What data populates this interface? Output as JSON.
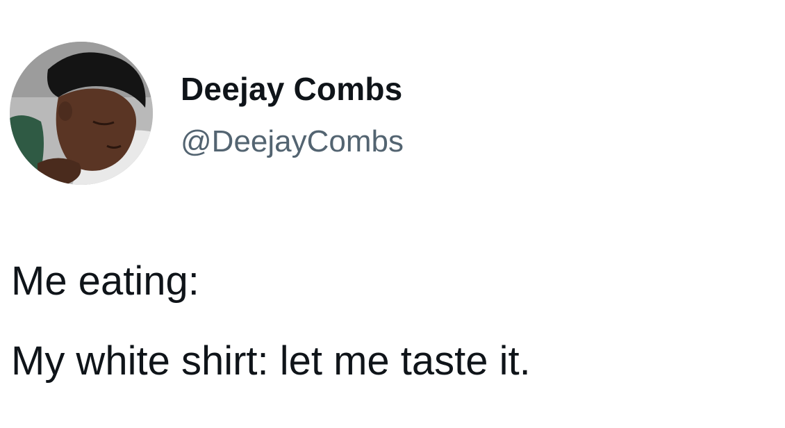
{
  "tweet": {
    "author": {
      "display_name": "Deejay Combs",
      "handle": "@DeejayCombs",
      "avatar_icon": "profile-photo"
    },
    "lines": [
      "Me eating:",
      "My white shirt: let me taste it."
    ]
  },
  "colors": {
    "background": "#ffffff",
    "text_primary": "#0f1419",
    "text_secondary": "#536471"
  }
}
